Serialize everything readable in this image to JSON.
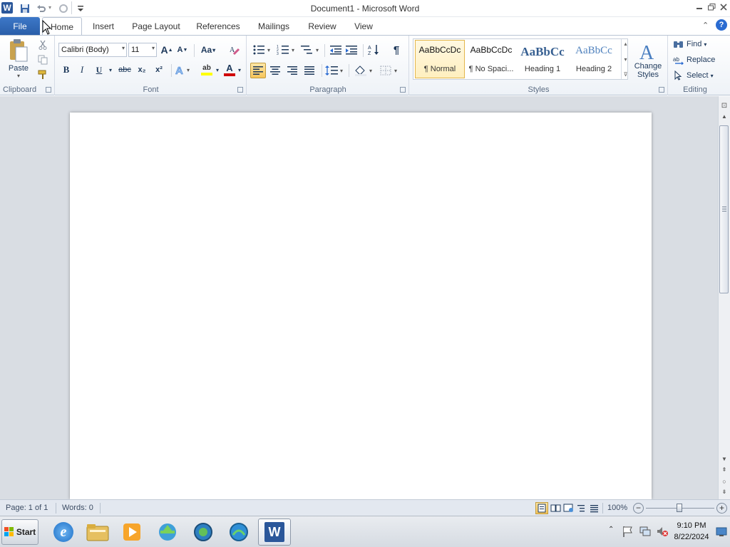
{
  "window": {
    "title": "Document1  -  Microsoft Word",
    "app_icon": "W"
  },
  "qat": {
    "icons": [
      "save-icon",
      "undo-icon",
      "redo-icon",
      "customize-qat-icon"
    ]
  },
  "tabs": {
    "file": "File",
    "home": "Home",
    "insert": "Insert",
    "page_layout": "Page Layout",
    "references": "References",
    "mailings": "Mailings",
    "review": "Review",
    "view": "View"
  },
  "clipboard": {
    "paste_label": "Paste",
    "group_label": "Clipboard"
  },
  "font": {
    "family": "Calibri (Body)",
    "size": "11",
    "group_label": "Font",
    "bold": "B",
    "italic": "I",
    "underline": "U",
    "strike": "abc",
    "subscript": "x₂",
    "superscript": "x²",
    "change_case": "Aa",
    "grow": "A",
    "shrink": "A",
    "font_color_letter": "A",
    "highlight_letter": "ab"
  },
  "paragraph": {
    "group_label": "Paragraph",
    "pilcrow": "¶"
  },
  "styles": {
    "group_label": "Styles",
    "items": [
      {
        "preview": "AaBbCcDc",
        "name": "¶ Normal"
      },
      {
        "preview": "AaBbCcDc",
        "name": "¶ No Spaci..."
      },
      {
        "preview": "AaBbCc",
        "name": "Heading 1"
      },
      {
        "preview": "AaBbCc",
        "name": "Heading 2"
      }
    ],
    "change_styles_line1": "Change",
    "change_styles_line2": "Styles"
  },
  "editing": {
    "group_label": "Editing",
    "find": "Find",
    "replace": "Replace",
    "select": "Select"
  },
  "status": {
    "page": "Page: 1 of 1",
    "words": "Words: 0",
    "zoom": "100%"
  },
  "taskbar": {
    "start_label": "Start",
    "time": "9:10 PM",
    "date": "8/22/2024",
    "apps": [
      "internet-explorer-icon",
      "folder-icon",
      "media-player-icon",
      "download-manager-icon",
      "globe-app-icon",
      "globe-app-2-icon",
      "word-icon"
    ]
  },
  "colors": {
    "accent": "#2a5ea9",
    "ribbon_bg": "#eef2f7",
    "doc_bg": "#d9dde3",
    "font_color": "#d00000",
    "highlight": "#ffff00"
  }
}
